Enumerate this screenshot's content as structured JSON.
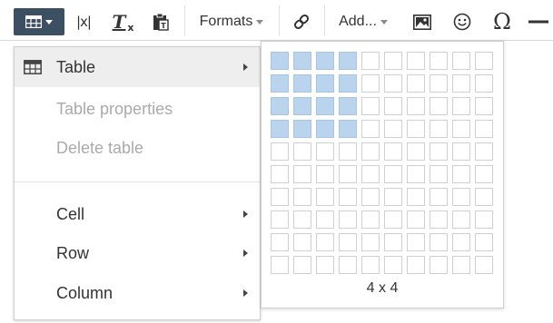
{
  "toolbar": {
    "table_icon": "table-icon",
    "variable_icon_text": "|x|",
    "clear_format_icon_text": "T",
    "clear_format_sub": "x",
    "paste_icon": "clipboard-icon",
    "formats_label": "Formats",
    "link_icon": "link-icon",
    "add_label": "Add...",
    "image_icon": "image-icon",
    "emoji_icon": "smiley-icon",
    "special_char_glyph": "Ω",
    "hr_glyph": "—"
  },
  "menu": {
    "items": [
      {
        "label": "Table",
        "state": "active",
        "has_submenu": true
      },
      {
        "label": "Table properties",
        "state": "disabled",
        "has_submenu": false
      },
      {
        "label": "Delete table",
        "state": "disabled",
        "has_submenu": false
      },
      {
        "label": "Cell",
        "state": "normal",
        "has_submenu": true
      },
      {
        "label": "Row",
        "state": "normal",
        "has_submenu": true
      },
      {
        "label": "Column",
        "state": "normal",
        "has_submenu": true
      }
    ]
  },
  "grid_picker": {
    "columns": 10,
    "rows": 10,
    "selected_columns": 4,
    "selected_rows": 4,
    "size_label": "4 x 4"
  },
  "colors": {
    "active_toolbar_bg": "#3d4f63",
    "selected_cell": "#bad4ee",
    "menu_hover": "#eeeeee",
    "disabled_text": "#aaaaaa"
  }
}
